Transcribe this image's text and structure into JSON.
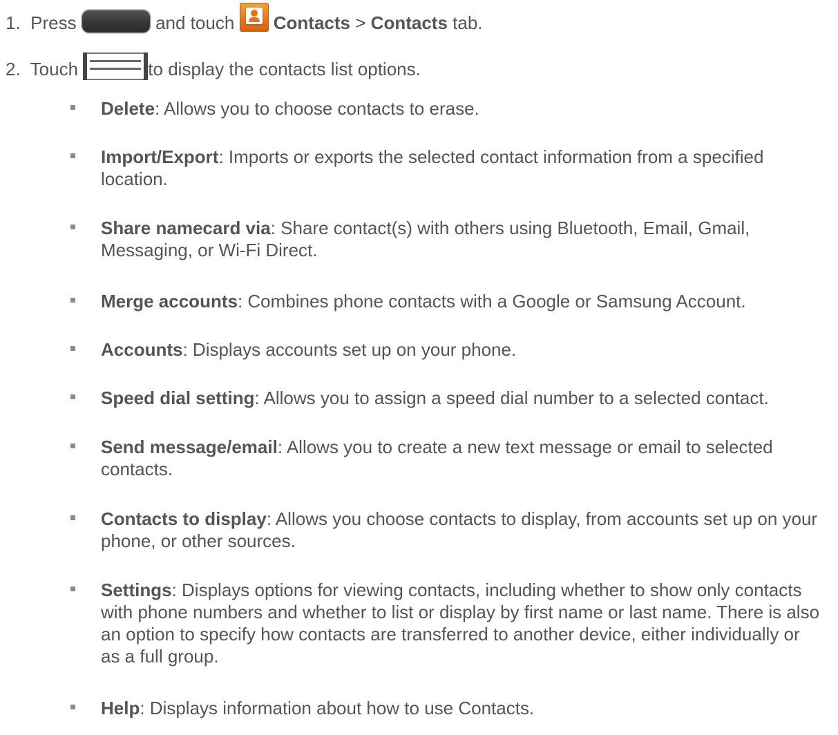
{
  "steps": [
    {
      "number": "1.",
      "parts": [
        "Press",
        "and touch",
        "Contacts",
        ">",
        "Contacts",
        "tab."
      ],
      "icons": [
        "home-button-icon",
        "contacts-app-icon"
      ]
    },
    {
      "number": "2.",
      "parts": [
        "Touch",
        "to display the contacts list options."
      ],
      "icons": [
        "menu-key-icon"
      ]
    }
  ],
  "options": [
    {
      "term": "Delete",
      "desc": ": Allows you to choose contacts to erase."
    },
    {
      "term": "Import/Export",
      "desc": ": Imports or exports the selected contact information from a specified location."
    },
    {
      "term": "Share namecard via",
      "desc": ": Share contact(s) with others using Bluetooth, Email, Gmail, Messaging, or Wi-Fi Direct."
    },
    {
      "term": "Merge accounts",
      "desc": ": Combines phone contacts with a Google or Samsung Account."
    },
    {
      "term": "Accounts",
      "desc": ": Displays accounts set up on your phone."
    },
    {
      "term": "Speed dial setting",
      "desc": ": Allows you to assign a speed dial number to a selected contact."
    },
    {
      "term": "Send message/email",
      "desc": ": Allows you to create a new text message or email to selected contacts."
    },
    {
      "term": "Contacts to display",
      "desc": ": Allows you choose contacts to display, from accounts set up on your phone, or other sources."
    },
    {
      "term": "Settings",
      "desc": ": Displays options for viewing contacts, including whether to show only contacts with phone numbers and whether to list or display by first name or last name. There is also an option to specify how contacts are transferred to another device, either individually or as a full group."
    },
    {
      "term": "Help",
      "desc": ": Displays information about how to use Contacts."
    }
  ],
  "colors": {
    "text": "#555555",
    "bullet": "#8a8a8a",
    "contacts_icon": "#e8731a"
  }
}
